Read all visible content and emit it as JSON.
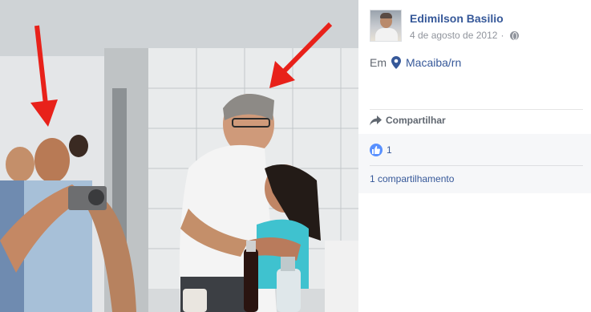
{
  "post": {
    "author_name": "Edimilson Basilio",
    "date": "4 de agosto de 2012",
    "date_separator": "·",
    "privacy_icon": "globe-icon",
    "location_prefix": "Em",
    "location": "Macaiba/rn",
    "location_icon": "map-pin-icon"
  },
  "actions": {
    "share_label": "Compartilhar",
    "share_icon": "share-arrow-icon"
  },
  "reactions": {
    "like_icon": "thumbs-up-icon",
    "like_count": "1",
    "shares_label": "1 compartilhamento"
  },
  "colors": {
    "link": "#365899",
    "muted": "#90949c",
    "reactions_bg": "#f6f7f9",
    "like_blue": "#5890ff",
    "arrow_red": "#e8211a"
  }
}
